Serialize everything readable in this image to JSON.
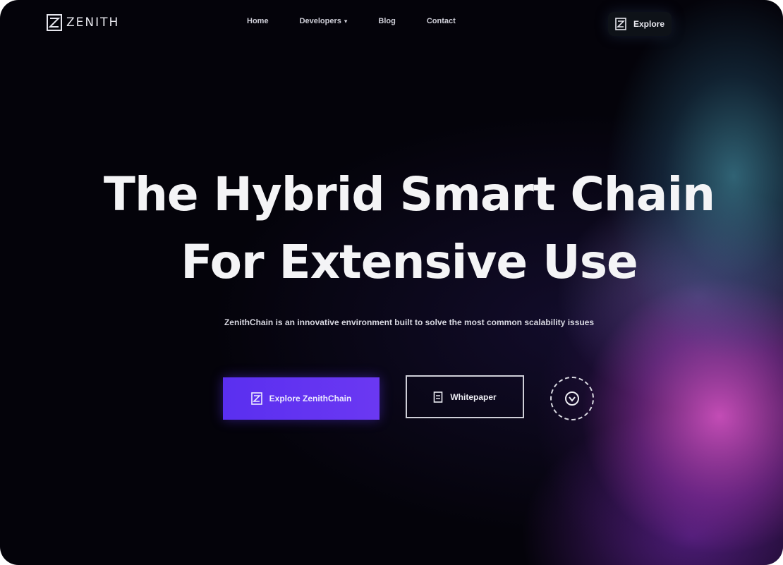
{
  "brand": {
    "logo_text": "ZENITH",
    "logo_icon": "zenith-logo-icon"
  },
  "nav": {
    "links": [
      {
        "label": "Home"
      },
      {
        "label": "Developers",
        "has_dropdown": true
      },
      {
        "label": "Blog"
      },
      {
        "label": "Contact"
      }
    ],
    "explore_label": "Explore",
    "explore_icon": "zenith-logo-icon"
  },
  "hero": {
    "title_line1": "The Hybrid Smart Chain",
    "title_line2": "For Extensive Use",
    "subtitle": "ZenithChain is an innovative environment built to solve the most common scalability issues"
  },
  "cta": {
    "primary_label": "Explore ZenithChain",
    "primary_icon": "zenith-logo-icon",
    "secondary_label": "Whitepaper",
    "secondary_icon": "document-icon",
    "circle_icon": "play-icon"
  },
  "colors": {
    "background": "#04030a",
    "accent": "#5a2ff0",
    "glow_teal": "#3e8296",
    "glow_pink": "#cd50be",
    "text": "#f4f4f6"
  }
}
